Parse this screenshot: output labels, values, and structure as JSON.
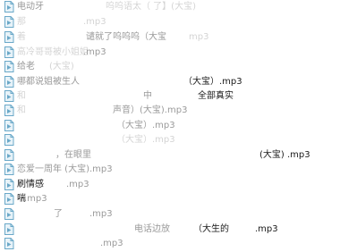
{
  "file_icon": "audio-file-icon",
  "colors": {
    "icon_stroke": "#6aa8c8",
    "icon_fill": "#e8f3f9",
    "text": "#1a1a1a",
    "faded_text": "#d4d4d4"
  },
  "files": [
    {
      "segs": [
        {
          "t": "电动牙",
          "c": "soft"
        },
        {
          "t": "呜呜语太（ 了】(大宝)",
          "c": "faint"
        }
      ]
    },
    {
      "segs": [
        {
          "t": "那",
          "c": "faint"
        },
        {
          "t": ".mp3",
          "c": "faint"
        }
      ]
    },
    {
      "segs": [
        {
          "t": "着",
          "c": "faint"
        },
        {
          "t": "谴就了呜呜呜（大宝",
          "c": "soft"
        },
        {
          "t": "mp3",
          "c": "faint"
        }
      ]
    },
    {
      "segs": [
        {
          "t": "高冷哥哥被小姐姐",
          "c": "faint"
        },
        {
          "t": ".mp3",
          "c": "soft"
        }
      ]
    },
    {
      "segs": [
        {
          "t": "给老",
          "c": "soft"
        },
        {
          "t": "(大宝)",
          "c": "faint"
        }
      ]
    },
    {
      "segs": [
        {
          "t": "哪都说姐被生人",
          "c": "soft"
        },
        {
          "t": "（大宝）.mp3",
          "c": "text"
        }
      ]
    },
    {
      "segs": [
        {
          "t": "和",
          "c": "faint"
        },
        {
          "t": "中",
          "c": "soft"
        },
        {
          "t": "全部真实",
          "c": "text"
        }
      ]
    },
    {
      "segs": [
        {
          "t": "和",
          "c": "faint"
        },
        {
          "t": "声音）(大宝).mp3",
          "c": "soft"
        }
      ]
    },
    {
      "segs": [
        {
          "t": "（大宝）.mp3",
          "c": "soft"
        }
      ]
    },
    {
      "segs": [
        {
          "t": "（大宝）.mp3",
          "c": "faint"
        }
      ]
    },
    {
      "segs": [
        {
          "t": "，在眼里",
          "c": "soft"
        },
        {
          "t": "(大宝) .mp3",
          "c": "text"
        }
      ]
    },
    {
      "segs": [
        {
          "t": "恋爱一周年 (大宝).mp3",
          "c": "soft"
        }
      ]
    },
    {
      "segs": [
        {
          "t": "刷情感",
          "c": "text"
        },
        {
          "t": ".mp3",
          "c": "soft"
        }
      ]
    },
    {
      "segs": [
        {
          "t": "喘",
          "c": "text"
        },
        {
          "t": ".mp3",
          "c": "soft"
        }
      ]
    },
    {
      "segs": [
        {
          "t": "了",
          "c": "soft"
        },
        {
          "t": ".mp3",
          "c": "soft"
        }
      ]
    },
    {
      "segs": [
        {
          "t": "电话边放",
          "c": "soft"
        },
        {
          "t": "（大生的",
          "c": "text"
        },
        {
          "t": ".mp3",
          "c": "text"
        }
      ]
    },
    {
      "segs": [
        {
          "t": ".mp3",
          "c": "soft"
        }
      ]
    }
  ]
}
